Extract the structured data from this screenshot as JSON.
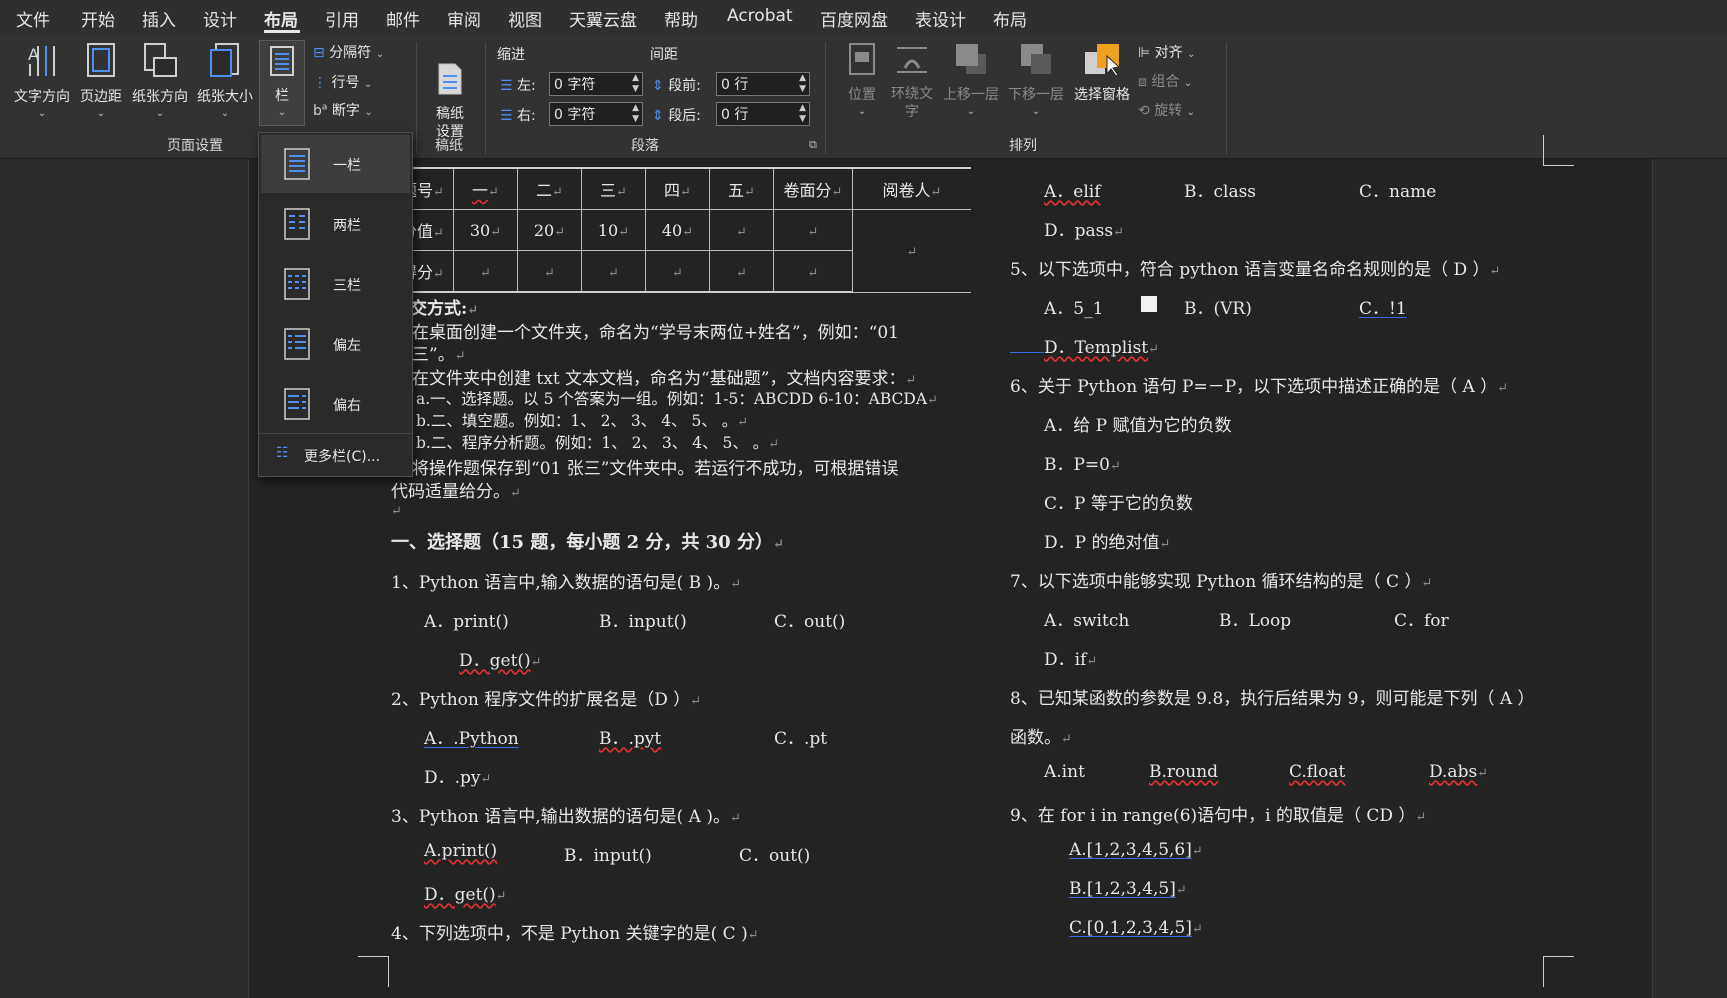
{
  "menubar": {
    "tabs": [
      "文件",
      "开始",
      "插入",
      "设计",
      "布局",
      "引用",
      "邮件",
      "审阅",
      "视图",
      "天翼云盘",
      "帮助",
      "Acrobat",
      "百度网盘",
      "表设计",
      "布局"
    ],
    "active_index": 4
  },
  "ribbon": {
    "page_setup": {
      "text_direction": "文字方向",
      "margins": "页边距",
      "orientation": "纸张方向",
      "size": "纸张大小",
      "columns": "栏",
      "breaks": "分隔符",
      "line_numbers": "行号",
      "hyphenation": "断字",
      "group_label": "页面设置"
    },
    "manuscript": {
      "label": "稿纸\n设置",
      "group_label": "稿纸"
    },
    "paragraph": {
      "indent_title": "缩进",
      "spacing_title": "间距",
      "left_label": "左:",
      "right_label": "右:",
      "left_value": "0 字符",
      "right_value": "0 字符",
      "before_label": "段前:",
      "after_label": "段后:",
      "before_value": "0 行",
      "after_value": "0 行",
      "group_label": "段落"
    },
    "arrange": {
      "position": "位置",
      "wrap_text_1": "环绕文",
      "wrap_text_2": "字",
      "bring_forward": "上移一层",
      "send_backward": "下移一层",
      "selection_pane": "选择窗格",
      "align": "对齐",
      "group": "组合",
      "rotate": "旋转",
      "group_label": "排列"
    }
  },
  "columns_menu": {
    "items": [
      "一栏",
      "两栏",
      "三栏",
      "偏左",
      "偏右"
    ],
    "selected_index": 0,
    "more": "更多栏(C)..."
  },
  "score_table": {
    "headers": [
      "题号",
      "一",
      "二",
      "三",
      "四",
      "五",
      "卷面分",
      "阅卷人"
    ],
    "row_score": [
      "分值",
      "30",
      "20",
      "10",
      "40",
      "",
      ""
    ],
    "row_got": [
      "得分",
      "",
      "",
      "",
      "",
      "",
      ""
    ]
  },
  "doc_left": {
    "submit_title": "交方式:",
    "l1": "在桌面创建一个文件夹，命名为“学号末两位+姓名”，例如：“01",
    "l1b": "三”。",
    "l2": "在文件夹中创建 txt 文本文档，命名为“基础题”，文档内容要求：",
    "l3": "a.一、选择题。以 5 个答案为一组。例如：1-5：ABCDD    6-10：ABCDA",
    "l4": "b.二、填空题。例如：1、    2、       3、       4、        5、        。",
    "l5": "b.二、程序分析题。例如：1、    2、       3、       4、        5、        。",
    "l6": "将操作题保存到“01 张三”文件夹中。若运行不成功，可根据错误",
    "l7": "代码适量给分。",
    "section": "一、选择题（15 题，每小题 2 分，共 30 分）",
    "q1": "1、Python 语言中,输入数据的语句是(   B )。",
    "q1a": "A．print()",
    "q1b": "B．input()",
    "q1c": "C．out()",
    "q1d": "D．get()",
    "q2": "2、Python 程序文件的扩展名是（D ）",
    "q2a": "A．.Python",
    "q2b": "B．.pyt",
    "q2c": "C．.pt",
    "q2d": "D．.py",
    "q3": "3、Python 语言中,输出数据的语句是(    A    )。",
    "q3a": "A.print()",
    "q3b": "B．input()",
    "q3c": "C．out()",
    "q3d": "D．get()",
    "q4": "4、下列选项中，不是 Python 关键字的是( C    )"
  },
  "doc_right": {
    "r1a": "A．elif",
    "r1b": "B．class",
    "r1c": "C．name",
    "r1d": "D．pass",
    "q5": "5、以下选项中，符合 python 语言变量名命名规则的是（  D ）",
    "q5a": "A．5_1",
    "q5b": "B．(VR)",
    "q5c": "C．!1",
    "q5d": "D．Templist",
    "q6": "6、关于 Python 语句 P=－P，以下选项中描述正确的是（   A ）",
    "q6a": "A．给 P 赋值为它的负数",
    "q6b": "B．P=0",
    "q6c": "C．P 等于它的负数",
    "q6d": "D．P 的绝对值",
    "q7": "7、以下选项中能够实现 Python 循环结构的是（  C  ）",
    "q7a": "A．switch",
    "q7b": "B．Loop",
    "q7c": "C．for",
    "q7d": "D．if",
    "q8": "8、已知某函数的参数是 9.8，执行后结果为 9，则可能是下列（   A  ）",
    "q8b": "函数。",
    "q8a1": "A.int",
    "q8a2": "B.round",
    "q8a3": "C.float",
    "q8a4": "D.abs",
    "q9": "9、在 for i in range(6)语句中，i 的取值是（    CD  ）",
    "q9a": "A.[1,2,3,4,5,6]",
    "q9b": "B.[1,2,3,4,5]",
    "q9c": "C.[0,1,2,3,4,5]"
  },
  "colors": {
    "accent_orange": "#f0a020",
    "doc_bg": "#232323",
    "ribbon_bg": "#323232"
  }
}
